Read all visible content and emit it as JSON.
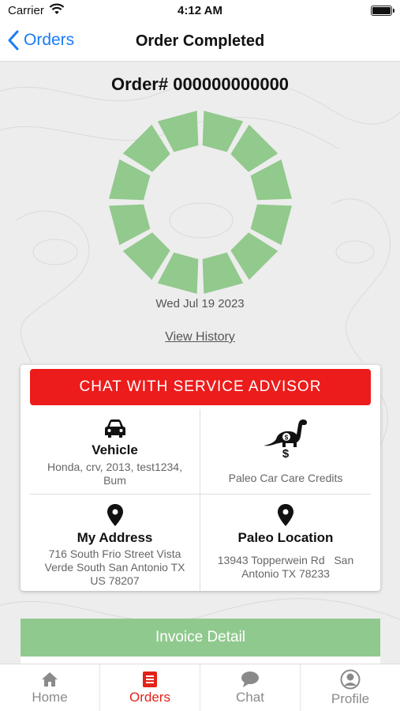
{
  "status_bar": {
    "carrier": "Carrier",
    "time": "4:12 AM"
  },
  "nav": {
    "back_label": "Orders",
    "title": "Order Completed"
  },
  "order": {
    "number": "Order# 000000000000",
    "date": "Wed Jul 19 2023",
    "view_history": "View History",
    "progress_segments_filled": 12,
    "progress_segments_total": 12
  },
  "card": {
    "chat_button": "CHAT WITH SERVICE ADVISOR",
    "vehicle": {
      "title": "Vehicle",
      "line1": "Honda, crv, 2013, test1234,",
      "line2": "Bum",
      "icon": "car-icon"
    },
    "credits": {
      "symbol": "$",
      "label": "Paleo Car Care Credits",
      "icon": "dinosaur-icon"
    },
    "address": {
      "title": "My Address",
      "line1": "716 South Frio Street Vista",
      "line2": "Verde South San Antonio TX",
      "line3": "US 78207",
      "icon": "location-pin-icon"
    },
    "location": {
      "title": "Paleo Location",
      "line1": "13943 Topperwein Rd   San",
      "line2": "Antonio TX 78233",
      "icon": "location-pin-icon"
    }
  },
  "invoice": {
    "label": "Invoice Detail"
  },
  "tabs": [
    {
      "label": "Home",
      "icon": "home-icon"
    },
    {
      "label": "Orders",
      "icon": "orders-icon"
    },
    {
      "label": "Chat",
      "icon": "chat-icon"
    },
    {
      "label": "Profile",
      "icon": "profile-icon"
    }
  ],
  "colors": {
    "accent_blue": "#1a7cf5",
    "chat_red": "#ec1c1c",
    "segment_green": "#92c98c",
    "invoice_green": "#90c98e",
    "active_tab": "#e2231a",
    "background": "#ededed"
  }
}
